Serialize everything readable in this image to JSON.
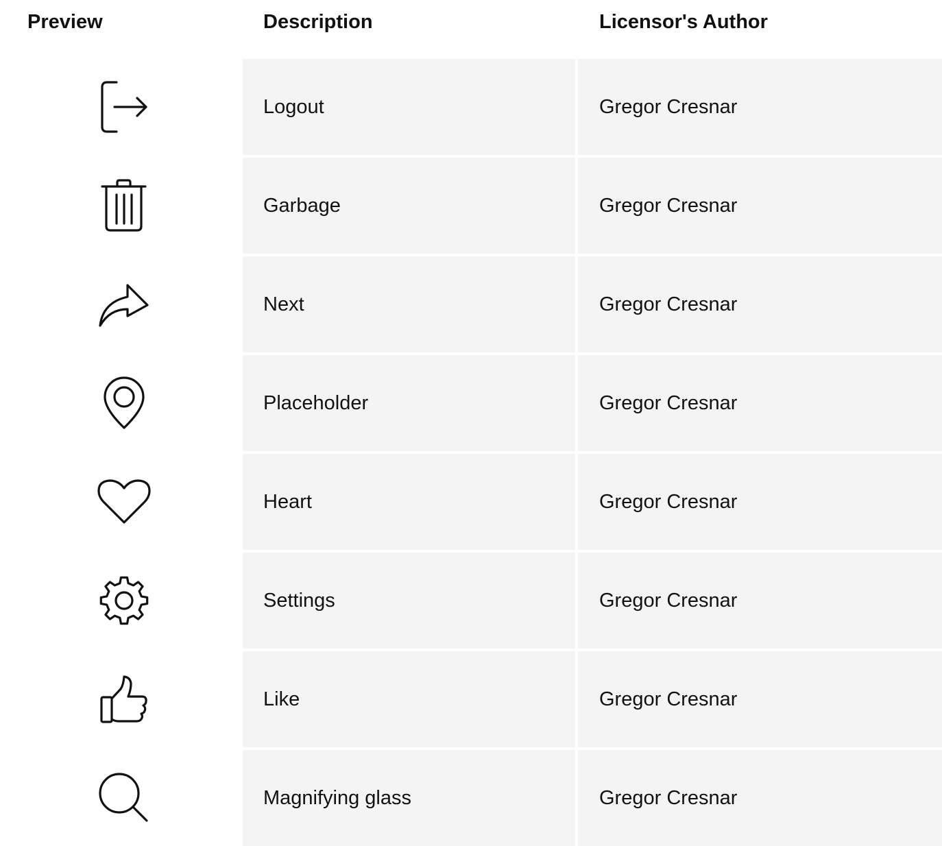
{
  "header": {
    "preview": "Preview",
    "description": "Description",
    "author": "Licensor's Author"
  },
  "rows": [
    {
      "icon": "logout-icon",
      "description": "Logout",
      "author": "Gregor Cresnar"
    },
    {
      "icon": "trash-icon",
      "description": "Garbage",
      "author": "Gregor Cresnar"
    },
    {
      "icon": "share-arrow-icon",
      "description": "Next",
      "author": "Gregor Cresnar"
    },
    {
      "icon": "map-pin-icon",
      "description": "Placeholder",
      "author": "Gregor Cresnar"
    },
    {
      "icon": "heart-icon",
      "description": "Heart",
      "author": "Gregor Cresnar"
    },
    {
      "icon": "gear-icon",
      "description": "Settings",
      "author": "Gregor Cresnar"
    },
    {
      "icon": "thumbs-up-icon",
      "description": "Like",
      "author": "Gregor Cresnar"
    },
    {
      "icon": "search-icon",
      "description": "Magnifying glass",
      "author": "Gregor Cresnar"
    }
  ],
  "colors": {
    "text": "#111111",
    "cell_background": "#f4f4f4",
    "page_background": "#ffffff"
  }
}
